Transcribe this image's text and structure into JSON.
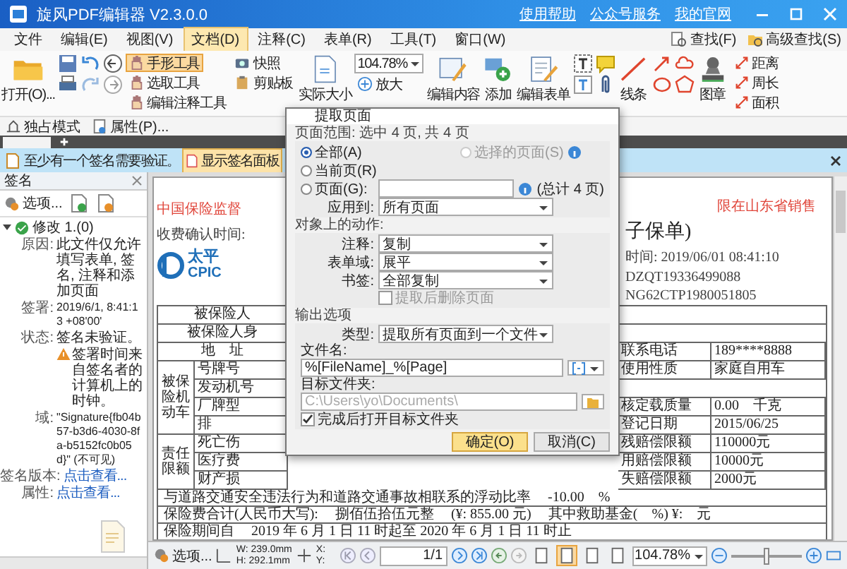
{
  "window": {
    "title": "旋风PDF编辑器 V2.3.0.0",
    "links": [
      "使用帮助",
      "公众号服务",
      "我的官网"
    ]
  },
  "menu": [
    {
      "label": "文件",
      "selected": false
    },
    {
      "label": "编辑(E)",
      "selected": false
    },
    {
      "label": "视图(V)",
      "selected": false
    },
    {
      "label": "文档(D)",
      "selected": true
    },
    {
      "label": "注释(C)",
      "selected": false
    },
    {
      "label": "表单(R)",
      "selected": false
    },
    {
      "label": "工具(T)",
      "selected": false
    },
    {
      "label": "窗口(W)",
      "selected": false
    }
  ],
  "search": [
    "查找(F)",
    "高级查找(S)"
  ],
  "ribbon": {
    "open": "打开(O)...",
    "tools": [
      {
        "label": "手形工具",
        "selected": true
      },
      {
        "label": "选取工具",
        "selected": false
      },
      {
        "label": "编辑注释工具",
        "selected": false
      }
    ],
    "snapshot": "快照",
    "clipboard": "剪贴板",
    "actual_size": "实际大小",
    "zoom": "104.78%",
    "zoom_in": "放大",
    "edit_content": "编辑内容",
    "add": "添加",
    "edit_form": "编辑表单",
    "line": "线条",
    "stamp": "图章",
    "measure": [
      "距离",
      "周长",
      "面积"
    ]
  },
  "modebar": [
    "独占模式",
    "属性(P)..."
  ],
  "notice": {
    "text": "至少有一个签名需要验证。",
    "button": "显示签名面板"
  },
  "signature_panel": {
    "title": "签名",
    "options": "选项...",
    "tree": [
      {
        "label": "修改 1.(0)",
        "expanded": true,
        "details": [
          {
            "kind": "text",
            "key": "原因:",
            "value": "此文件仅允许填写表单, 签名, 注释和添加页面"
          },
          {
            "kind": "text",
            "key": "签署:",
            "value": "2019/6/1, 8:41:13 +08'00'"
          },
          {
            "kind": "text",
            "key": "状态:",
            "value": "签名未验证。"
          },
          {
            "kind": "warning",
            "value": "签署时间来自签名者的计算机上的时钟。"
          },
          {
            "kind": "text",
            "key": "域:",
            "value": "\"Signature{fb04b57-b3d6-4030-8fa-b5152fc0b05d}\" (不可见)"
          },
          {
            "kind": "link",
            "key": "签名版本:",
            "value": "点击查看..."
          },
          {
            "kind": "link",
            "key": "属性:",
            "value": "点击查看..."
          }
        ]
      }
    ]
  },
  "document": {
    "left_header": [
      "中国保险监督",
      "收费确认时间:"
    ],
    "logo": [
      "太平",
      "CPIC"
    ],
    "right_header": [
      "限在山东省销售",
      "子保单)",
      "时间: 2019/06/01 08:41:10",
      "DZQT19336499088",
      "NG62CTP1980051805"
    ],
    "left_rows": [
      {
        "label": "被保险人"
      },
      {
        "label": "被保险人身"
      },
      {
        "label": "地　址"
      },
      {
        "group": "被保险机动车",
        "items": [
          "号牌号",
          "发动机号",
          "厂牌型",
          "排"
        ]
      },
      {
        "group": "责任限额",
        "items": [
          "死亡伤",
          "医疗费",
          "财产损"
        ]
      }
    ],
    "right_rows": [
      {},
      {},
      {
        "label": "联系电话",
        "value": "189****8888"
      },
      {
        "label": "使用性质",
        "value": "家庭自用车"
      },
      {},
      {
        "label": "核定载质量",
        "value": "0.00　千克"
      },
      {
        "label": "登记日期",
        "value": "2015/06/25"
      },
      {
        "label": "残赔偿限额",
        "value": "110000元"
      },
      {
        "label": "用赔偿限额",
        "value": "10000元"
      },
      {
        "label": "失赔偿限额",
        "value": "2000元"
      }
    ],
    "full_rows": [
      [
        "与道路交通安全违法行为和道路交通事故相联系的浮动比率",
        "-10.00　%"
      ],
      [
        "保险费合计(人民币大写):",
        "捌佰伍拾伍元整",
        "(¥: 855.00 元)",
        "其中救助基金(　%) ¥:　元"
      ],
      [
        "保险期间自",
        "2019 年 6 月 1 日 11 时起至 2020 年 6 月 1 日 11 时止"
      ]
    ]
  },
  "dialog": {
    "title": "提取页面",
    "range_header": "页面范围: 选中 4 页, 共 4 页",
    "range_options": [
      {
        "label": "全部(A)",
        "selected": true,
        "disabled": false
      },
      {
        "label": "选择的页面(S)",
        "selected": false,
        "disabled": true
      },
      {
        "label": "当前页(R)",
        "selected": false,
        "disabled": false
      },
      {
        "label": "页面(G):",
        "selected": false,
        "disabled": false
      }
    ],
    "pages_total": "(总计 4 页)",
    "apply_label": "应用到:",
    "apply_value": "所有页面",
    "objects_header": "对象上的动作:",
    "object_fields": [
      {
        "label": "注释:",
        "value": "复制"
      },
      {
        "label": "表单域:",
        "value": "展平"
      },
      {
        "label": "书签:",
        "value": "全部复制"
      }
    ],
    "delete_after": {
      "label": "提取后删除页面",
      "checked": false,
      "disabled": true
    },
    "output_header": "输出选项",
    "type_label": "类型:",
    "type_value": "提取所有页面到一个文件",
    "filename_label": "文件名:",
    "filename_value": "%[FileName]_%[Page]",
    "folder_label": "目标文件夹:",
    "folder_value": "C:\\Users\\yo\\Documents\\",
    "folder_disabled": true,
    "open_after": {
      "label": "完成后打开目标文件夹",
      "checked": true,
      "disabled": false
    },
    "buttons": [
      {
        "label": "确定(O)",
        "default": true
      },
      {
        "label": "取消(C)",
        "default": false
      }
    ]
  },
  "status": {
    "options": "选项...",
    "width": "W: 239.0mm",
    "height": "H: 292.1mm",
    "x": "X:",
    "y": "Y:",
    "page": "1/1",
    "view_modes": [
      {
        "selected": false
      },
      {
        "selected": true
      },
      {
        "selected": false
      },
      {
        "selected": false
      }
    ],
    "zoom": "104.78%",
    "zoom_slider": {
      "level": 0.5
    }
  }
}
